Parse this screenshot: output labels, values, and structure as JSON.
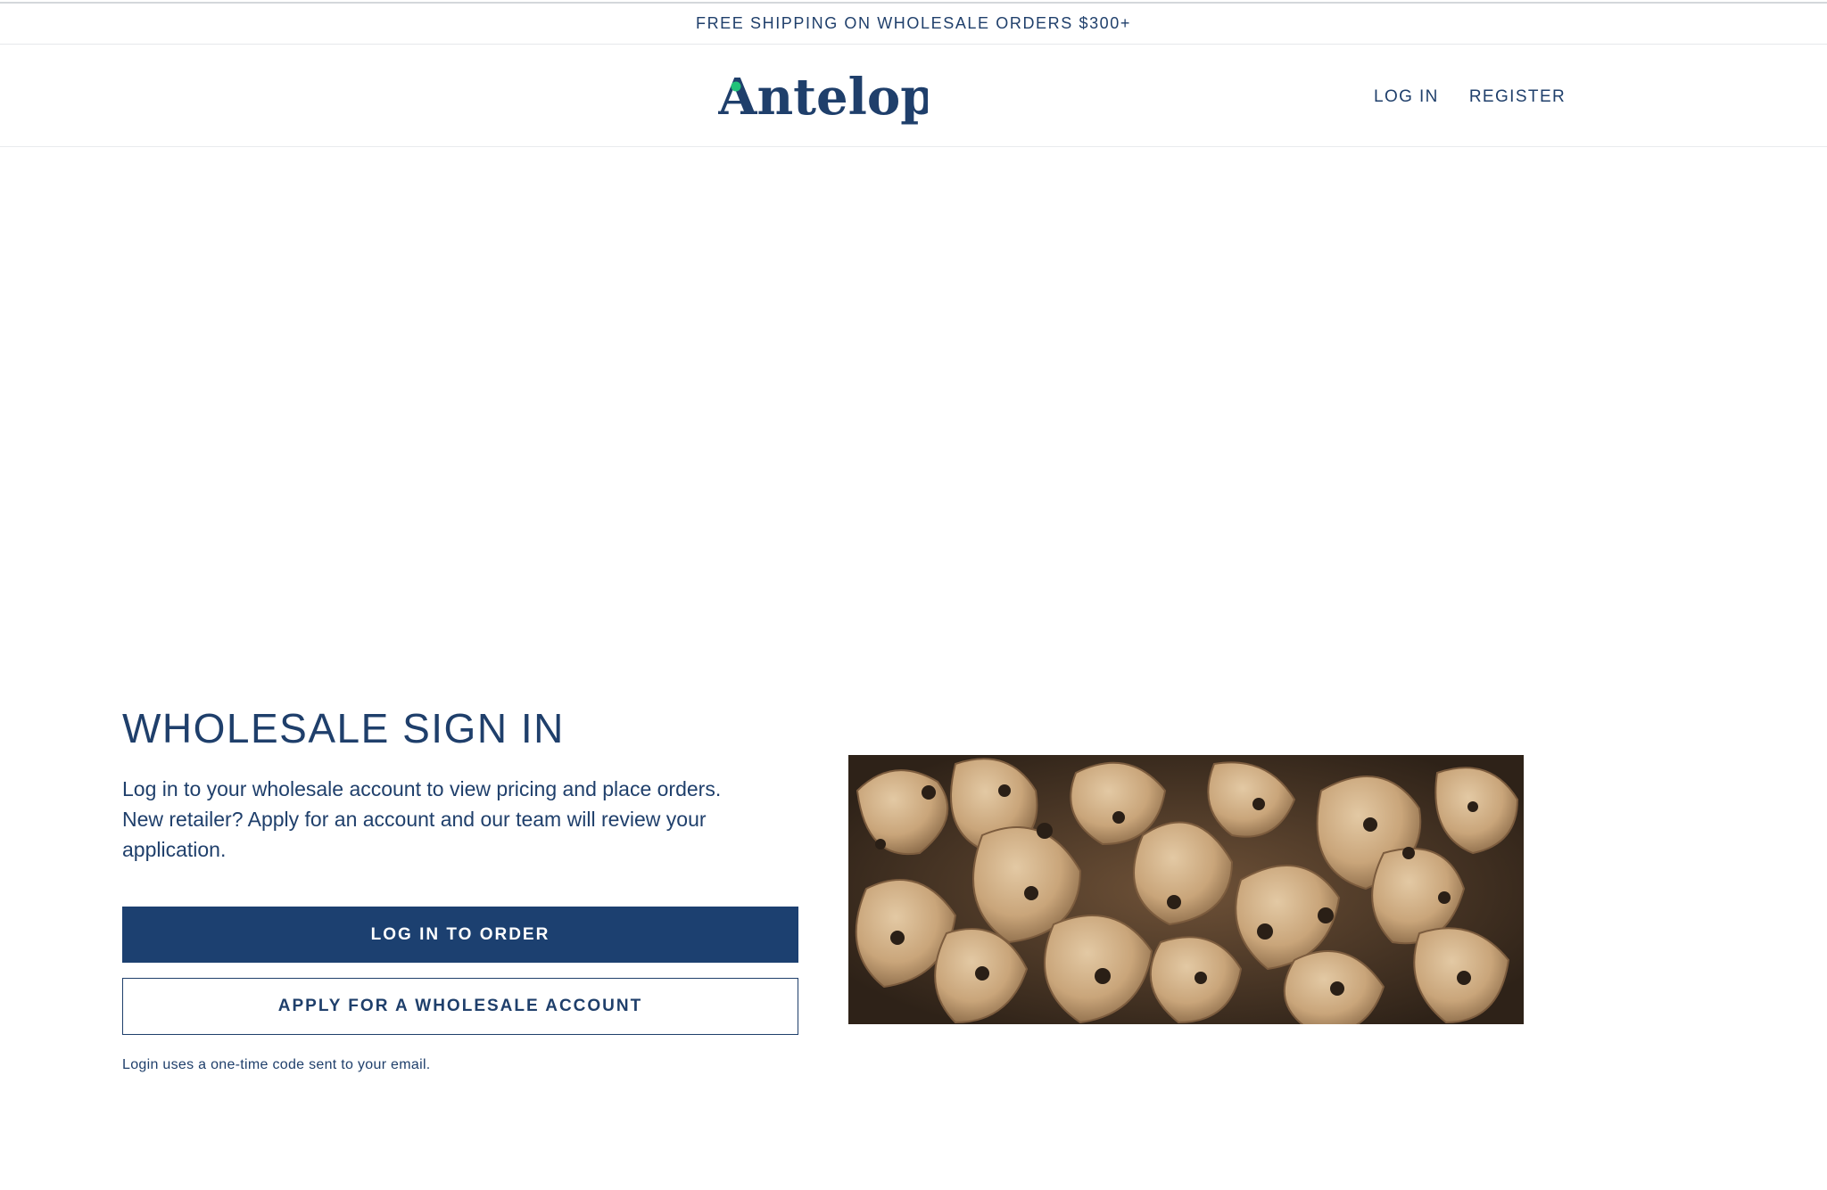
{
  "announcement": {
    "text": "FREE SHIPPING ON WHOLESALE ORDERS $300+"
  },
  "header": {
    "logo_text": "Antelope",
    "nav": [
      {
        "label": "LOG IN"
      },
      {
        "label": "REGISTER"
      }
    ]
  },
  "main": {
    "title": "WHOLESALE SIGN IN",
    "intro": "Log in to your wholesale account to view pricing and place orders. New retailer? Apply for an account and our team will review your application.",
    "login_button": "LOG IN TO ORDER",
    "apply_button": "APPLY FOR A WHOLESALE ACCOUNT",
    "helper_text": "Login uses a one-time code sent to your email."
  },
  "image": {
    "subject": "dog-treats-photo"
  },
  "colors": {
    "brand_navy": "#1c4070",
    "logo_dot_green": "#22c27a",
    "background": "#ffffff"
  }
}
